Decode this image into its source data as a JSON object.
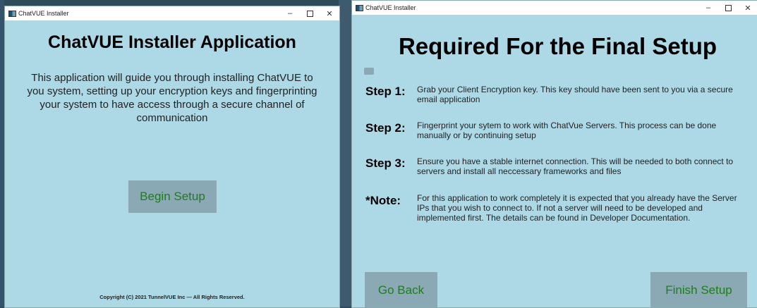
{
  "left_window": {
    "title": "ChatVUE Installer",
    "heading": "ChatVUE Installer Application",
    "description": "This application will guide you through installing ChatVUE to you system, setting up your encryption keys and fingerprinting your system to have access through a secure channel of communication",
    "begin_button": "Begin Setup",
    "copyright": "Copyright (C) 2021 TunnelVUE Inc — All Rights Reserved."
  },
  "right_window": {
    "title": "ChatVUE Installer",
    "heading": "Required For the Final Setup",
    "steps": [
      {
        "label": "Step 1:",
        "text": "Grab your Client Encryption key. This key should have been sent to you via a secure email application"
      },
      {
        "label": "Step 2:",
        "text": "Fingerprint your sytem to work with ChatVue Servers. This process can be done manually or by continuing setup"
      },
      {
        "label": "Step 3:",
        "text": "Ensure you have a stable internet connection. This will be needed to both connect to servers and install all neccessary frameworks and files"
      },
      {
        "label": "*Note:",
        "text": "For this application to work completely it is expected that you already have the Server IPs that you wish to connect to. If not a server will need to be developed and implemented first. The details can be found in Developer Documentation."
      }
    ],
    "back_button": "Go Back",
    "finish_button": "Finish Setup"
  },
  "window_controls": {
    "minimize": "–",
    "close": "✕"
  },
  "colors": {
    "window_bg": "#add8e6",
    "button_bg": "#8ba9b4",
    "button_text": "#1e7d1e"
  }
}
